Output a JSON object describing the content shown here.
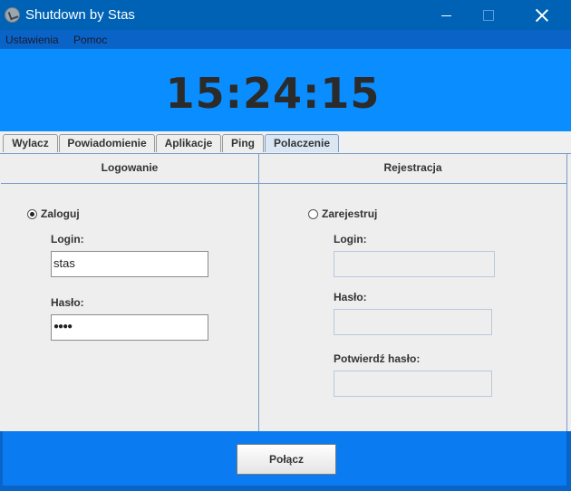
{
  "window": {
    "title": "Shutdown by Stas"
  },
  "menu": {
    "items": [
      "Ustawienia",
      "Pomoc"
    ]
  },
  "clock": {
    "time": "15:24:15"
  },
  "tabs": [
    {
      "label": "Wylacz"
    },
    {
      "label": "Powiadomienie"
    },
    {
      "label": "Aplikacje"
    },
    {
      "label": "Ping"
    },
    {
      "label": "Polaczenie",
      "active": true
    }
  ],
  "login_panel": {
    "header": "Logowanie",
    "radio_label": "Zaloguj",
    "selected": true,
    "login_label": "Login:",
    "login_value": "stas",
    "password_label": "Hasło:",
    "password_value": "●●●●"
  },
  "register_panel": {
    "header": "Rejestracja",
    "radio_label": "Zarejestruj",
    "selected": false,
    "login_label": "Login:",
    "login_value": "",
    "password_label": "Hasło:",
    "password_value": "",
    "confirm_label": "Potwierdź hasło:",
    "confirm_value": ""
  },
  "footer": {
    "connect_label": "Połącz"
  }
}
